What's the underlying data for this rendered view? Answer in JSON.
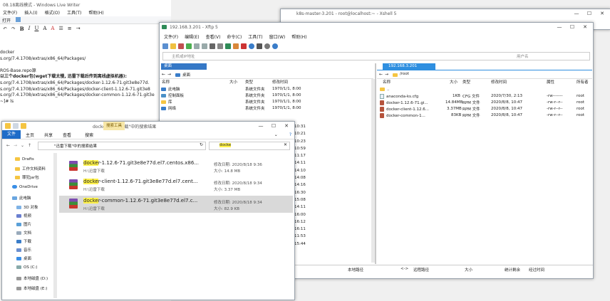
{
  "wlw": {
    "title": "08.18离线模式 - Windows Live Writer",
    "menus": [
      "文件(F)",
      "插入(I)",
      "格式(O)",
      "工具(T)",
      "帮助(H)"
    ],
    "lines": [
      "docker",
      "s.org/7.4.1708/extras/x86_64/Packages/",
      "",
      "ROS-Base.repo源",
      "以三个docker包(wget下载太慢, 迅雷下载后传到离线虚拟机器):",
      "s.org/7.4.1708/extras/x86_64/Packages/docker-1.12.6-71.git3e8e77d.",
      "s.org/7.4.1708/extras/x86_64/Packages/docker-client-1.12.6-71.git3e8",
      "s.org/7.4.1708/extras/x86_64/Packages/docker-common-1.12.6-71.git3e",
      "~]# ls"
    ]
  },
  "xshell": {
    "title": "k8s-master-3.201 - root@localhost:~ - Xshell 5"
  },
  "xftp": {
    "title": "192.168.3.201 - Xftp 5",
    "menus": [
      "文件(F)",
      "编辑(E)",
      "查看(V)",
      "命令(C)",
      "工具(T)",
      "窗口(W)",
      "帮助(H)"
    ],
    "host_placeholder": "主机或IP地址",
    "user_placeholder": "用户名",
    "left_tab": "桌面",
    "left_path": "桌面",
    "right_tab": "192.168.3.201",
    "right_path": "/root",
    "columns": [
      "名称",
      "大小",
      "类型",
      "修改时间"
    ],
    "right_columns": [
      "名称",
      "大小",
      "类型",
      "修改时间",
      "属性",
      "所有者"
    ],
    "left_rows": [
      {
        "name": "此电脑",
        "type": "系统文件夹",
        "date": "1970/1/1, 8:00"
      },
      {
        "name": "控制面板",
        "type": "系统文件夹",
        "date": "1970/1/1, 8:00"
      },
      {
        "name": "库",
        "type": "系统文件夹",
        "date": "1970/1/1, 8:00"
      },
      {
        "name": "网络",
        "type": "系统文件夹",
        "date": "1970/1/1, 8:00"
      }
    ],
    "right_rows": [
      {
        "name": "..",
        "size": "",
        "type": "",
        "date": "",
        "attr": "",
        "owner": ""
      },
      {
        "name": "anaconda-ks.cfg",
        "size": "1KB",
        "type": "CFG 文件",
        "date": "2020/7/30, 2:13",
        "attr": "-rw-------",
        "owner": "root"
      },
      {
        "name": "docker-1.12.6-71.gi...",
        "size": "14.84MB",
        "type": "RPM 文件",
        "date": "2020/8/8, 10:47",
        "attr": "-rw-r--r--",
        "owner": "root"
      },
      {
        "name": "docker-client-1.12.6...",
        "size": "3.37MB",
        "type": "RPM 文件",
        "date": "2020/8/8, 10:47",
        "attr": "-rw-r--r--",
        "owner": "root"
      },
      {
        "name": "docker-common-1...",
        "size": "83KB",
        "type": "RPM 文件",
        "date": "2020/8/8, 10:47",
        "attr": "-rw-r--r--",
        "owner": "root"
      }
    ],
    "left_times": [
      "10:31",
      "10:21",
      "10:23",
      "10:59",
      "11:17",
      "14:11",
      "14:10",
      "14:08",
      "14:16",
      "16:30",
      "15:08",
      "14:11",
      "16:00",
      "16:12",
      "16:11",
      "11:53",
      "15:44"
    ],
    "transfer_cols": [
      "本地路径",
      "<->",
      "远程路径",
      "大小",
      "统计剩余",
      "经过时间"
    ]
  },
  "explorer": {
    "title": "docke - \"迅雷下载\"中的搜索结果",
    "ribbon_tabs": [
      "文件",
      "主页",
      "共享",
      "查看"
    ],
    "ribbon_context": "搜索工具",
    "ribbon_context_tab": "搜索",
    "address": "\"迅雷下载\"中的搜索结果",
    "search_value": "docke",
    "nav_items": [
      {
        "label": "Drafts",
        "kind": "folder"
      },
      {
        "label": "工作文档资料",
        "kind": "folder"
      },
      {
        "label": "罪犯jar包",
        "kind": "folder"
      },
      {
        "label": "OneDrive",
        "kind": "cloud"
      },
      {
        "label": "此电脑",
        "kind": "pc"
      },
      {
        "label": "3D 对象",
        "kind": "folder"
      },
      {
        "label": "视频",
        "kind": "folder"
      },
      {
        "label": "图片",
        "kind": "folder"
      },
      {
        "label": "文档",
        "kind": "folder"
      },
      {
        "label": "下载",
        "kind": "folder"
      },
      {
        "label": "音乐",
        "kind": "folder"
      },
      {
        "label": "桌面",
        "kind": "folder"
      },
      {
        "label": "OS (C:)",
        "kind": "drive"
      },
      {
        "label": "本地磁盘 (D:)",
        "kind": "drive"
      },
      {
        "label": "本地磁盘 (E:)",
        "kind": "drive"
      }
    ],
    "results": [
      {
        "name_hl": "docke",
        "name_rest": "r-1.12.6-71.git3e8e77d.el7.centos.x86...",
        "path": "H:\\迅雷下载",
        "date_label": "修改日期:",
        "date": "2020/8/18 9:36",
        "size_label": "大小:",
        "size": "14.8 MB"
      },
      {
        "name_hl": "docke",
        "name_rest": "r-client-1.12.6-71.git3e8e77d.el7.cent...",
        "path": "H:\\迅雷下载",
        "date_label": "修改日期:",
        "date": "2020/8/18 9:34",
        "size_label": "大小:",
        "size": "3.37 MB"
      },
      {
        "name_hl": "docke",
        "name_rest": "r-common-1.12.6-71.git3e8e77d.el7.c...",
        "path": "H:\\迅雷下载",
        "date_label": "修改日期:",
        "date": "2020/8/18 9:34",
        "size_label": "大小:",
        "size": "82.9 KB"
      }
    ]
  }
}
